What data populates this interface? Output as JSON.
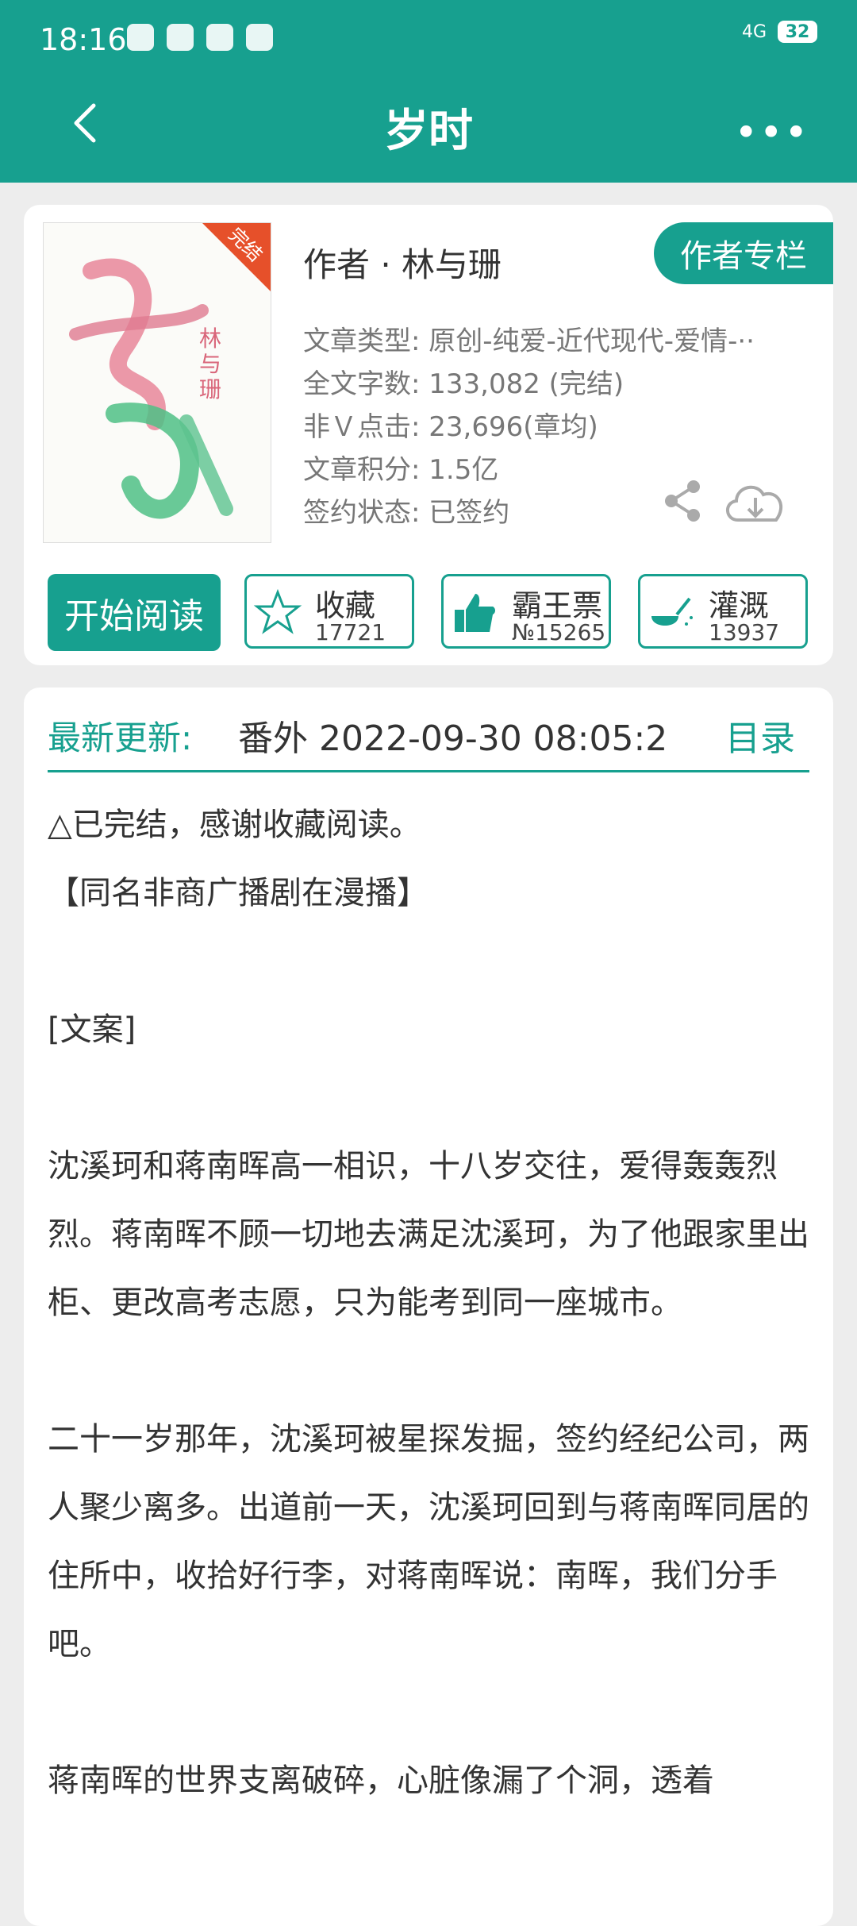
{
  "status_bar": {
    "time": "18:16",
    "battery": "32",
    "network": "4G"
  },
  "header": {
    "title": "岁时"
  },
  "book": {
    "cover_title": "岁时",
    "cover_author": "林与珊",
    "cover_badge": "完结",
    "author_line": "作者 · 林与珊",
    "author_column_button": "作者专栏",
    "info": [
      "文章类型: 原创-纯爱-近代现代-爱情-··",
      "全文字数: 133,082 (完结)",
      "非Ｖ点击: 23,696(章均)",
      "文章积分: 1.5亿",
      "签约状态: 已签约"
    ]
  },
  "actions": {
    "read_label": "开始阅读",
    "favorite": {
      "label": "收藏",
      "count": "17721"
    },
    "vote": {
      "label": "霸王票",
      "count": "№15265"
    },
    "water": {
      "label": "灌溉",
      "count": "13937"
    }
  },
  "latest_update": {
    "label": "最新更新:",
    "value": "番外  2022-09-30 08:05:2",
    "toc": "目录"
  },
  "content": [
    "△已完结，感谢收藏阅读。",
    "【同名非商广播剧在漫播】",
    "",
    "[文案]",
    "",
    "沈溪珂和蒋南晖高一相识，十八岁交往，爱得轰轰烈烈。蒋南晖不顾一切地去满足沈溪珂，为了他跟家里出柜、更改高考志愿，只为能考到同一座城市。",
    "",
    "二十一岁那年，沈溪珂被星探发掘，签约经纪公司，两人聚少离多。出道前一天，沈溪珂回到与蒋南晖同居的住所中，收拾好行李，对蒋南晖说：南晖，我们分手吧。",
    "",
    "蒋南晖的世界支离破碎，心脏像漏了个洞，透着"
  ],
  "colors": {
    "accent": "#17a08f",
    "background": "#ededed"
  }
}
